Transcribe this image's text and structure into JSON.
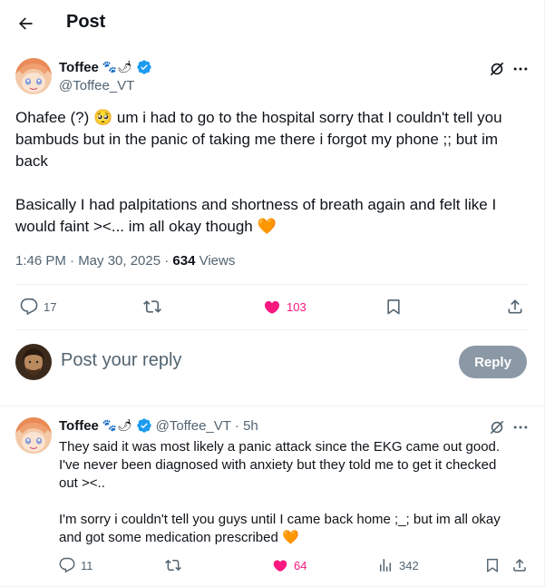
{
  "header": {
    "title": "Post"
  },
  "post": {
    "author_name": "Toffee",
    "author_emoji": "🐾🌶",
    "handle": "@Toffee_VT",
    "text_p1": "Ohafee (?) 🥺 um i had to go to the hospital sorry that I couldn't tell you bambuds but in the panic of taking me there i forgot my phone ;; but im back",
    "text_p2": "Basically I had palpitations and shortness of breath again and felt like I would faint ><... im all okay though 🧡",
    "time": "1:46 PM · May 30, 2025 · ",
    "views_count": "634",
    "views_label": " Views",
    "replies": "17",
    "likes": "103",
    "liked": true
  },
  "composer": {
    "placeholder": "Post your reply",
    "button": "Reply"
  },
  "reply": {
    "author_name": "Toffee",
    "author_emoji": "🐾🌶",
    "handle": "@Toffee_VT",
    "time": "· 5h",
    "text": "They said it was most likely a panic attack since the EKG came out good. I've never been diagnosed with anxiety but they told me to get it checked out ><..\n\nI'm sorry i couldn't tell you guys until I came back home ;_; but im all okay and got some medication prescribed 🧡",
    "replies": "11",
    "likes": "64",
    "views": "342"
  },
  "colors": {
    "accent": "#1d9bf0",
    "like": "#f91880",
    "muted": "#536471",
    "reply_button": "#8b98a5"
  }
}
